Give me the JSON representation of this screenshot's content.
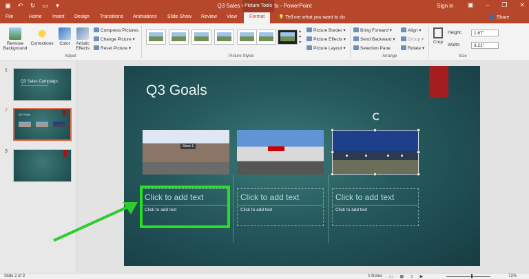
{
  "titlebar": {
    "title": "Q3 Sales Campaign.pptx - PowerPoint",
    "tools_label": "Picture Tools",
    "signin": "Sign in"
  },
  "tabs": [
    "File",
    "Home",
    "Insert",
    "Design",
    "Transitions",
    "Animations",
    "Slide Show",
    "Review",
    "View",
    "Format"
  ],
  "active_tab": "Format",
  "tell_me": "Tell me what you want to do",
  "share": "Share",
  "ribbon": {
    "remove_background": "Remove Background",
    "corrections": "Corrections",
    "color": "Color",
    "artistic_effects": "Artistic Effects",
    "compress": "Compress Pictures",
    "change": "Change Picture",
    "reset": "Reset Picture",
    "adjust_label": "Adjust",
    "picture_styles_label": "Picture Styles",
    "picture_border": "Picture Border",
    "picture_effects": "Picture Effects",
    "picture_layout": "Picture Layout",
    "bring_forward": "Bring Forward",
    "send_backward": "Send Backward",
    "selection_pane": "Selection Pane",
    "align": "Align",
    "group": "Group",
    "rotate": "Rotate",
    "arrange_label": "Arrange",
    "crop": "Crop",
    "height_label": "Height:",
    "height_value": "1.67\"",
    "width_label": "Width:",
    "width_value": "3.21\"",
    "size_label": "Size"
  },
  "thumbnails": [
    {
      "num": "1",
      "title": "Q3 Sales Campaign"
    },
    {
      "num": "2",
      "title": "Q3 Goals"
    },
    {
      "num": "3",
      "title": ""
    }
  ],
  "slide": {
    "title": "Q3 Goals",
    "store_sign": "Store 1",
    "placeholders": [
      {
        "title": "Click to add text",
        "body": "Click to add text"
      },
      {
        "title": "Click to add text",
        "body": "Click to add text"
      },
      {
        "title": "Click to add text",
        "body": "Click to add text"
      }
    ]
  },
  "status": {
    "slide_of": "Slide 2 of 3",
    "notes": "Notes",
    "zoom": "72%"
  },
  "colors": {
    "accent": "#b7472a",
    "highlight": "#27e021",
    "arrow": "#2ecc2e"
  }
}
